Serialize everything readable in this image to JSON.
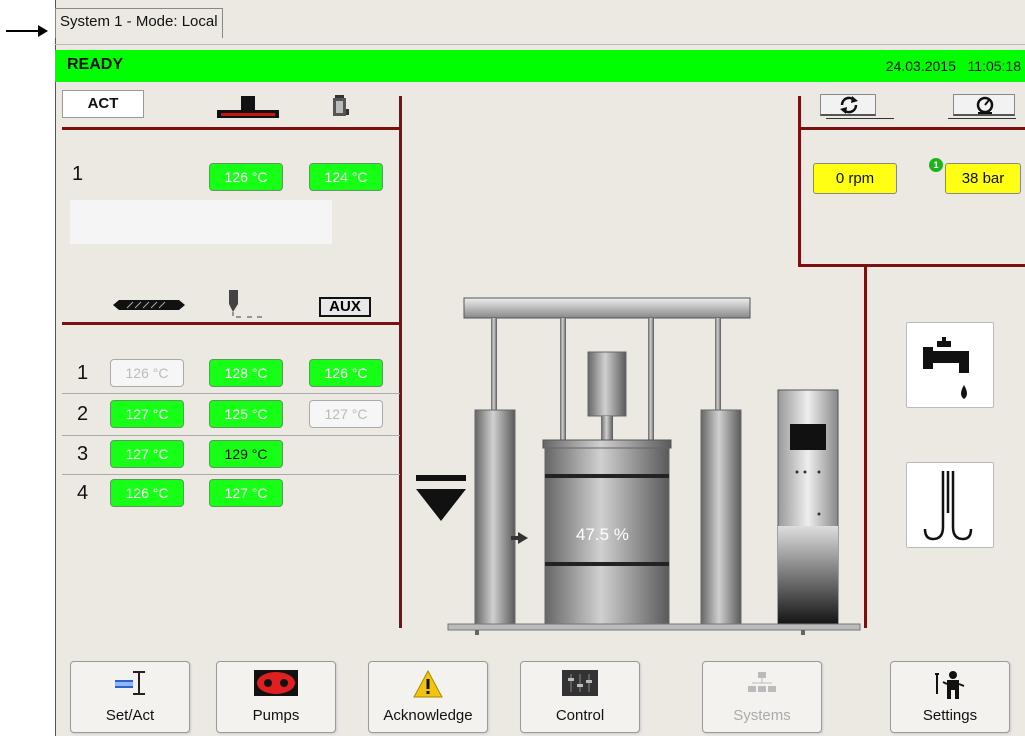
{
  "tab": {
    "label": "System 1 - Mode: Local"
  },
  "status": {
    "text": "READY",
    "date": "24.03.2015",
    "time": "11:05:18"
  },
  "left_top": {
    "act_label": "ACT",
    "row_number": "1",
    "temps": [
      "126 °C",
      "124 °C"
    ]
  },
  "left_bottom": {
    "aux_label": "AUX",
    "rows": [
      {
        "num": "1",
        "temps": [
          "126 °C",
          "128 °C",
          "126 °C"
        ]
      },
      {
        "num": "2",
        "temps": [
          "127 °C",
          "125 °C",
          "127 °C"
        ]
      },
      {
        "num": "3",
        "temps": [
          "127 °C",
          "129 °C"
        ]
      },
      {
        "num": "4",
        "temps": [
          "126 °C",
          "127 °C"
        ]
      }
    ]
  },
  "right_top": {
    "rpm": "0 rpm",
    "pressure": "38 bar",
    "badge": "1"
  },
  "drum": {
    "fill_label": "47.5 %",
    "fill_percent": 47.5
  },
  "nav": {
    "set_act": "Set/Act",
    "pumps": "Pumps",
    "acknowledge": "Acknowledge",
    "control": "Control",
    "systems": "Systems",
    "settings": "Settings"
  },
  "colors": {
    "ok_green": "#00ff00",
    "divider": "#7a1010",
    "value_yellow": "#ffff14"
  }
}
